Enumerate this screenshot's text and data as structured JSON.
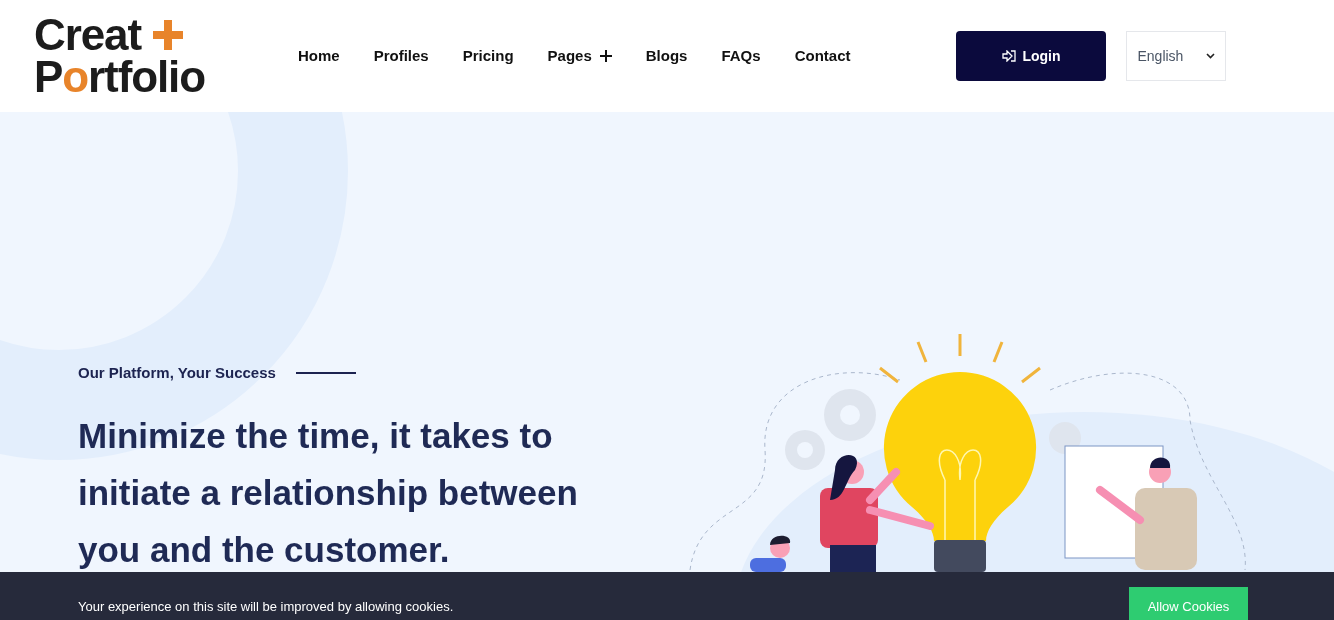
{
  "header": {
    "logo": {
      "line_1": "Creat",
      "line_2": "Portfolio"
    },
    "nav": [
      {
        "label": "Home",
        "has_submenu": false
      },
      {
        "label": "Profiles",
        "has_submenu": false
      },
      {
        "label": "Pricing",
        "has_submenu": false
      },
      {
        "label": "Pages",
        "has_submenu": true
      },
      {
        "label": "Blogs",
        "has_submenu": false
      },
      {
        "label": "FAQs",
        "has_submenu": false
      },
      {
        "label": "Contact",
        "has_submenu": false
      }
    ],
    "login_button": "Login",
    "language": "English"
  },
  "hero": {
    "tagline": "Our Platform, Your Success",
    "heading": "Minimize the time, it takes to initiate a relationship between you and the customer."
  },
  "cookie_bar": {
    "message": "Your experience on this site will be improved by allowing cookies.",
    "button": "Allow Cookies"
  }
}
